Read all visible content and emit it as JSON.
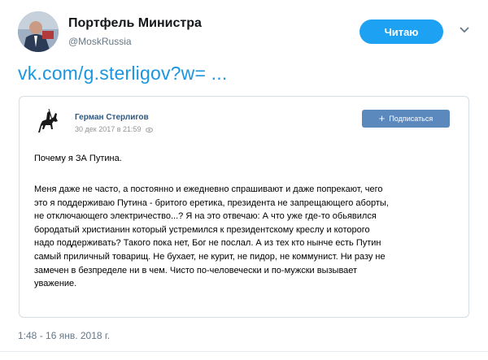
{
  "profile": {
    "display_name": "Портфель Министра",
    "handle": "@MoskRussia",
    "follow_label": "Читаю"
  },
  "tweet": {
    "link_text": "vk.com/g.sterligov?w= ...",
    "timestamp": "1:48 - 16 янв. 2018 г."
  },
  "card": {
    "author": "Герман Стерлигов",
    "date": "30 дек 2017 в 21:59",
    "subscribe_label": "Подписаться",
    "post_title": "Почему я ЗА Путина.",
    "post_lines": [
      "Меня даже не часто, а постоянно и ежедневно спрашивают и даже попрекают, чего",
      "это я поддерживаю Путина - бритого еретика, президента не запрещающего аборты,",
      "не отключающего электричество...? Я на это отвечаю: А что уже где-то обьявился",
      "бородатый христианин который устремился к президентскому креслу и которого",
      "надо поддерживать? Такого пока нет, Бог не послал. А из тех кто нынче есть Путин",
      "самый приличный товарищ. Не бухает, не курит, не пидор, не коммунист. Ни разу не",
      "замечен в безпределе ни в чем. Чисто по-человечески и по-мужски вызывает",
      "уважение."
    ]
  },
  "colors": {
    "follow_button": "#1da1f2",
    "link": "#1b95e0",
    "subscribe_button": "#5b88bd",
    "author_name": "#2a5885"
  }
}
